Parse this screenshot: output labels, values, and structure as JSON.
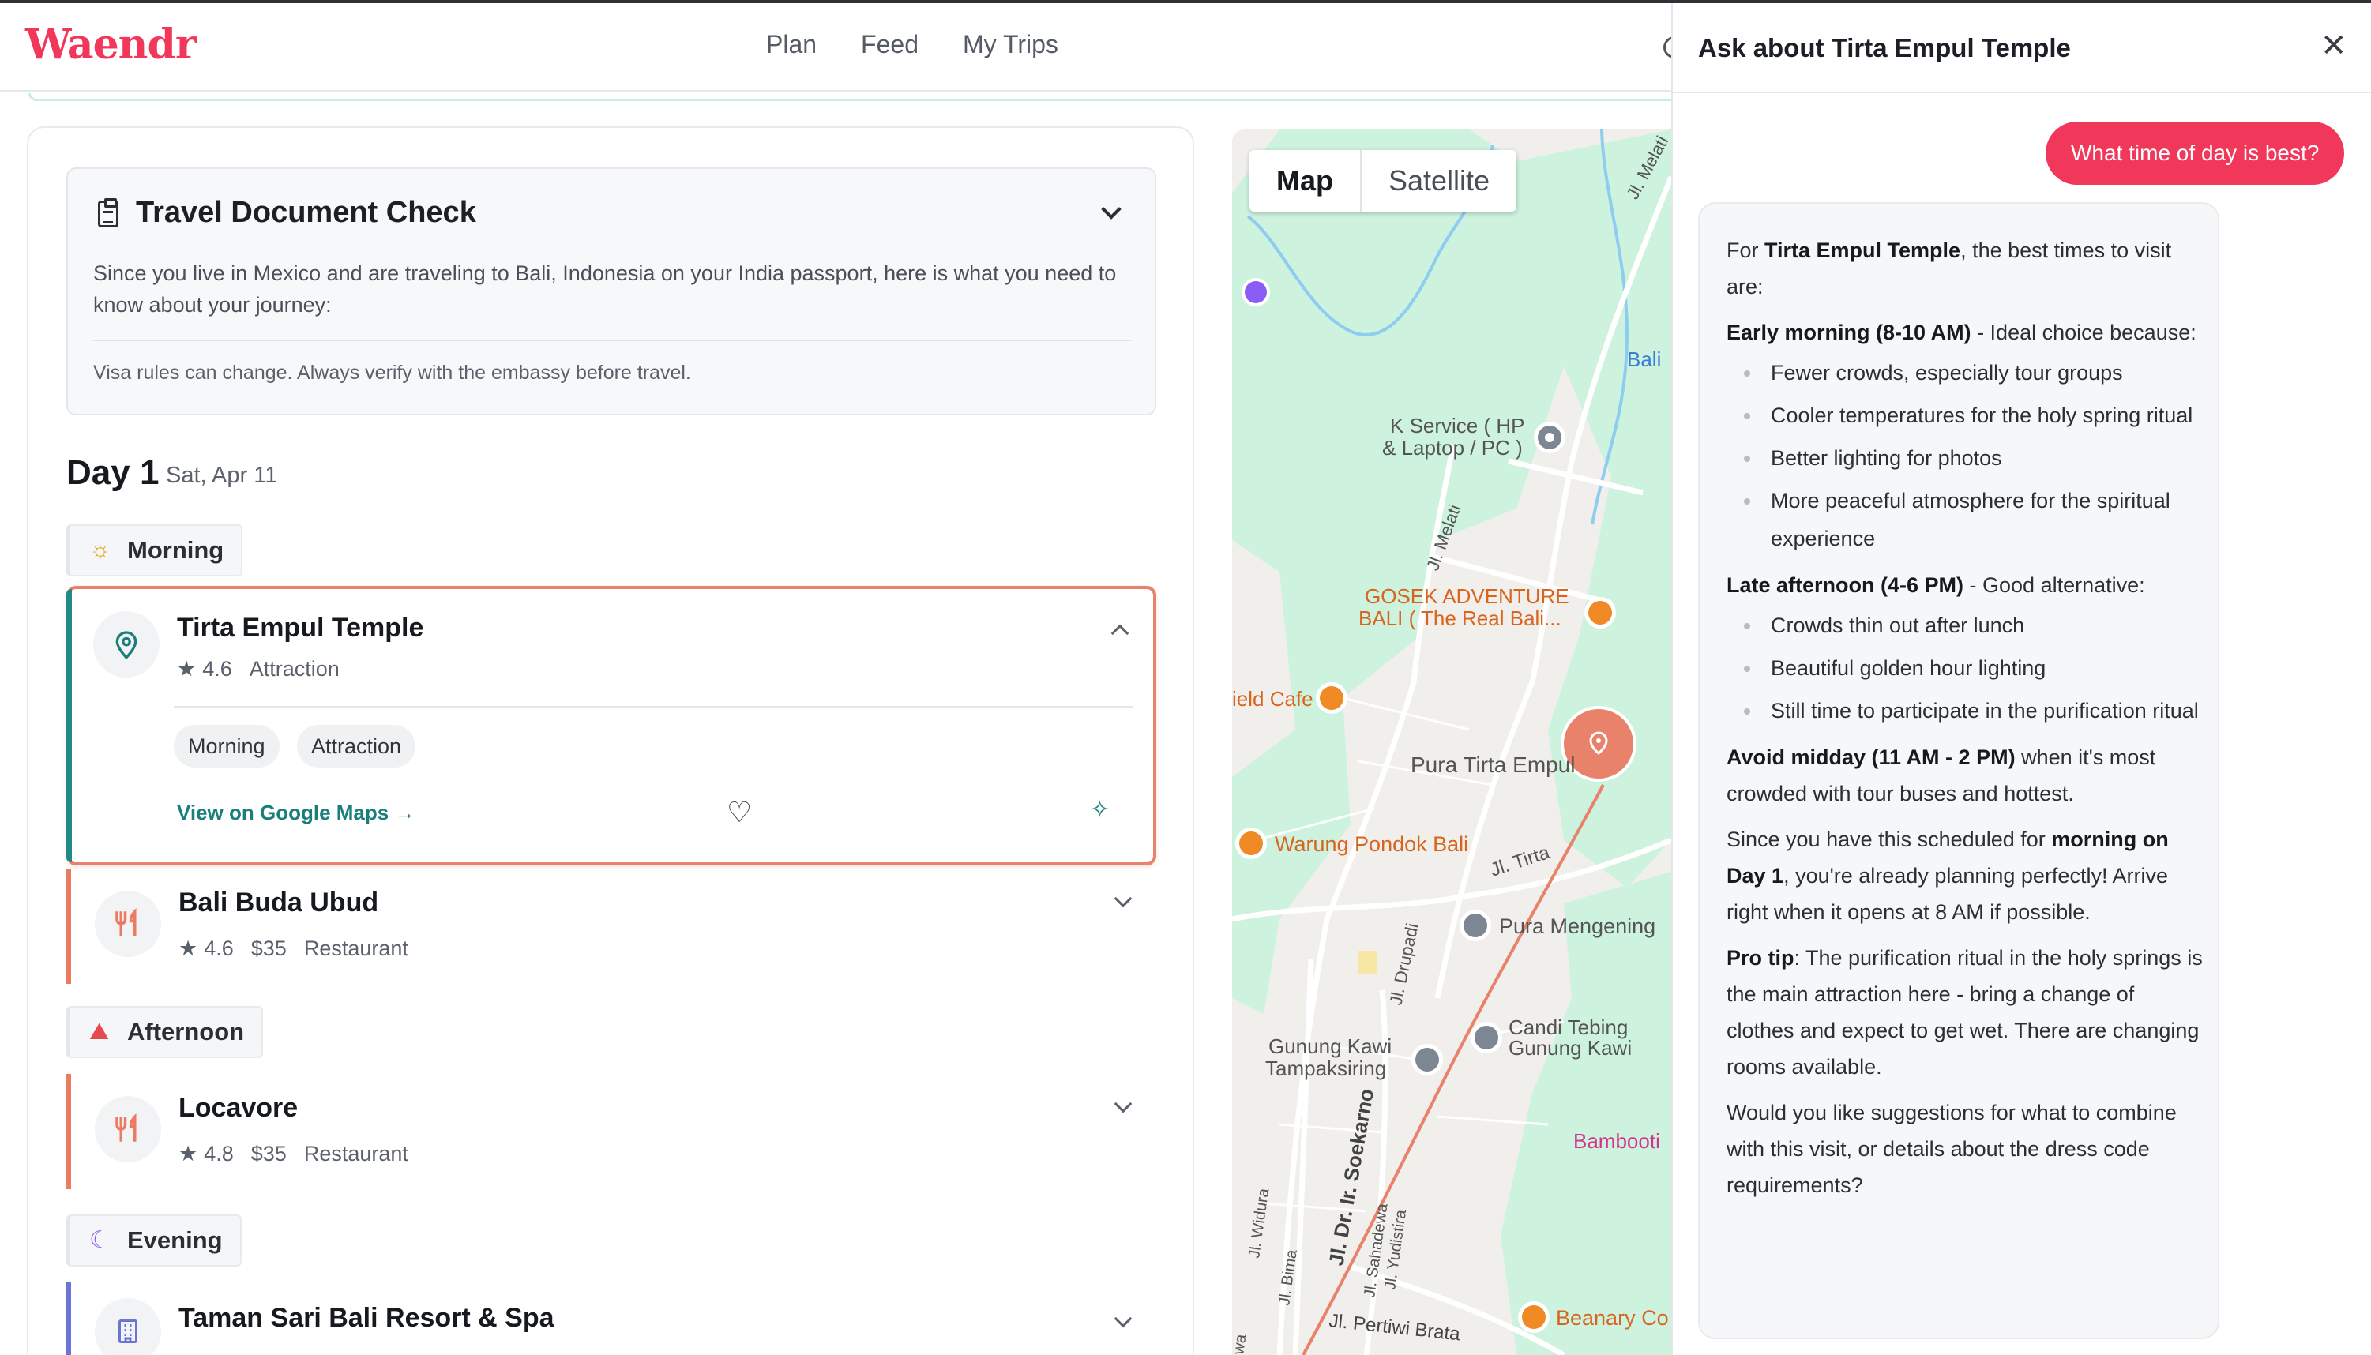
{
  "app": {
    "logo": "Waendr"
  },
  "nav": {
    "items": [
      "Plan",
      "Feed",
      "My Trips"
    ]
  },
  "doc_check": {
    "title": "Travel Document Check",
    "body": "Since you live in Mexico and are traveling to Bali, Indonesia on your India passport, here is what you need to know about your journey:",
    "note": "Visa rules can change. Always verify with the embassy before travel."
  },
  "day": {
    "title": "Day 1",
    "date": "Sat, Apr 11"
  },
  "periods": {
    "morning": "Morning",
    "afternoon": "Afternoon",
    "evening": "Evening"
  },
  "activities": [
    {
      "title": "Tirta Empul Temple",
      "rating": "4.6",
      "price": "",
      "category": "Attraction",
      "tags": [
        "Morning",
        "Attraction"
      ],
      "link": "View on Google Maps →"
    },
    {
      "title": "Bali Buda Ubud",
      "rating": "4.6",
      "price": "$35",
      "category": "Restaurant"
    },
    {
      "title": "Locavore",
      "rating": "4.8",
      "price": "$35",
      "category": "Restaurant"
    },
    {
      "title": "Taman Sari Bali Resort & Spa",
      "rating": "",
      "price": "",
      "category": ""
    }
  ],
  "map": {
    "toggle": {
      "map": "Map",
      "satellite": "Satellite"
    },
    "labels": {
      "melati_top": "Jl. Melati",
      "bali": "Bali",
      "k_service": "K Service ( HP",
      "k_service2": "& Laptop / PC )",
      "melati_mid": "Jl. Melati",
      "gosek1": "GOSEK ADVENTURE",
      "gosek2": "BALI ( The Real Bali...",
      "field_cafe": "ield Cafe",
      "pura_tirta": "Pura Tirta Empul",
      "warung": "Warung Pondok Bali",
      "jl_tirta": "Jl. Tirta",
      "pura_mengening": "Pura Mengening",
      "drupadi": "Jl. Drupadi",
      "candi1": "Candi Tebing",
      "candi2": "Gunung Kawi",
      "gunung1": "Gunung Kawi",
      "gunung2": "Tampaksiring",
      "bamboo": "Bambooti",
      "widura": "Jl. Widura",
      "bima": "Jl. Bima",
      "soekarno": "Jl. Dr. Ir. Soekarno",
      "sahadewa": "Jl. Sahadewa",
      "yudistira": "Jl. Yudistira",
      "pertiwi": "Jl. Pertiwi Brata",
      "beanary": "Beanary Co",
      "wa": "wa"
    }
  },
  "chat": {
    "title": "Ask about Tirta Empul Temple",
    "user_message": "What time of day is best?",
    "ai": {
      "intro_pre": "For ",
      "intro_bold": "Tirta Empul Temple",
      "intro_post": ", the best times to visit are:",
      "early_bold": "Early morning (8-10 AM)",
      "early_post": " - Ideal choice because:",
      "early_items": [
        "Fewer crowds, especially tour groups",
        "Cooler temperatures for the holy spring ritual",
        "Better lighting for photos",
        "More peaceful atmosphere for the spiritual experience"
      ],
      "late_bold": "Late afternoon (4-6 PM)",
      "late_post": " - Good alternative:",
      "late_items": [
        "Crowds thin out after lunch",
        "Beautiful golden hour lighting",
        "Still time to participate in the purification ritual"
      ],
      "avoid_bold": "Avoid midday (11 AM - 2 PM)",
      "avoid_post": " when it's most crowded with tour buses and hottest.",
      "sched_pre": "Since you have this scheduled for ",
      "sched_bold": "morning on Day 1",
      "sched_post": ", you're already planning perfectly! Arrive right when it opens at 8 AM if possible.",
      "tip_bold": "Pro tip",
      "tip_post": ": The purification ritual in the holy springs is the main attraction here - bring a change of clothes and expect to get wet. There are changing rooms available.",
      "closing": "Would you like suggestions for what to combine with this visit, or details about the dress code requirements?"
    }
  },
  "colors": {
    "brand": "#f1375a",
    "teal": "#1a7f7a",
    "coral": "#ec7b62"
  }
}
